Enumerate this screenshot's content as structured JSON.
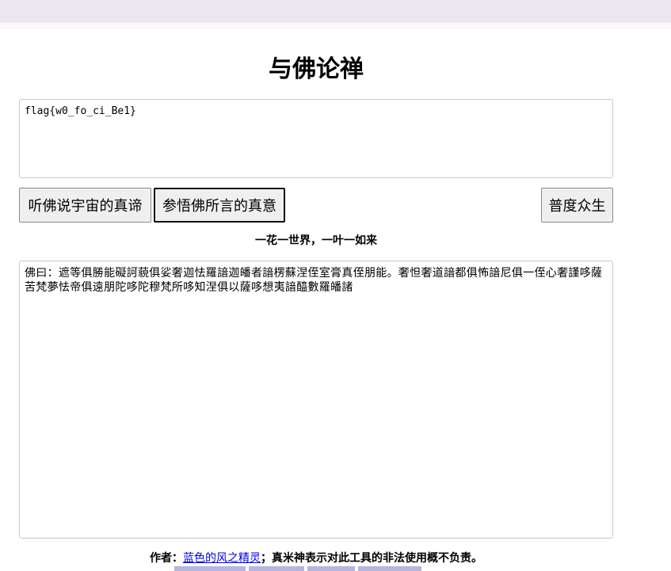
{
  "title": "与佛论禅",
  "input": {
    "value": "flag{w0_fo_ci_Be1}"
  },
  "buttons": {
    "encode": "听佛说宇宙的真谛",
    "decode": "参悟佛所言的真意",
    "save": "普度众生"
  },
  "motto": "一花一世界，一叶一如来",
  "output": {
    "value": "佛曰：遮等俱勝能礙訶藐俱娑奢迦怯羅諳迦皤者諳楞蘇涅侄室膏真侄朋能。奢怛奢道諳都俱怖諳尼俱一侄心奢謹哆薩苦梵夢怯帝俱遠朋陀哆陀穆梵所哆知涅俱以薩哆想夷諳醯數羅皤諸"
  },
  "footer": {
    "author_label": "作者：",
    "author_link": "蓝色的风之精灵",
    "disclaimer": "；真米神表示对此工具的非法使用概不负责。"
  }
}
